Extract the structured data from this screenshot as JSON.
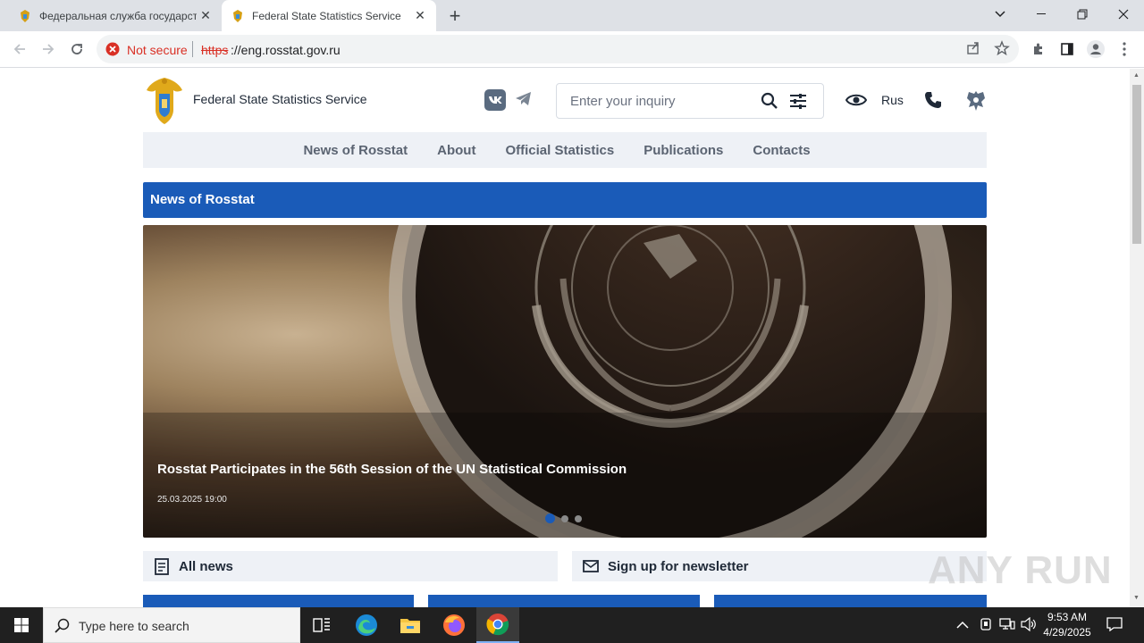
{
  "browser": {
    "tabs": [
      {
        "title": "Федеральная служба государст",
        "active": false
      },
      {
        "title": "Federal State Statistics Service",
        "active": true
      }
    ],
    "new_tab": "+",
    "security_label": "Not secure",
    "url_scheme": "https",
    "url_rest": "://eng.rosstat.gov.ru"
  },
  "site": {
    "name": "Federal State Statistics Service",
    "search_placeholder": "Enter your inquiry",
    "language": "Rus",
    "nav": [
      "News of Rosstat",
      "About",
      "Official Statistics",
      "Publications",
      "Contacts"
    ],
    "section_title": "News of Rosstat",
    "slide": {
      "headline": "Rosstat Participates in the 56th Session of the UN Statistical Commission",
      "date": "25.03.2025 19:00",
      "total_slides": 3,
      "active_slide": 1
    },
    "tiles": {
      "all_news": "All news",
      "newsletter": "Sign up for newsletter"
    }
  },
  "watermark": "ANY RUN",
  "taskbar": {
    "search_placeholder": "Type here to search",
    "time": "9:53 AM",
    "date": "4/29/2025"
  },
  "colors": {
    "brand_blue": "#1a5bb8",
    "chrome_bar": "#dee1e6",
    "taskbar": "#202020",
    "insecure_red": "#d93025"
  }
}
